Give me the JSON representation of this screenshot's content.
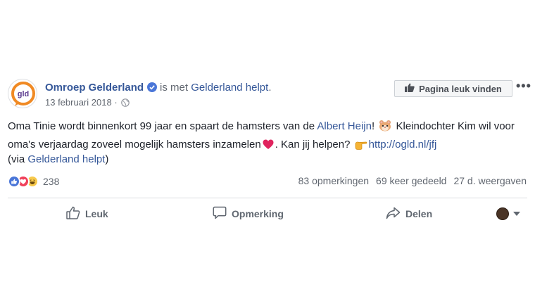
{
  "post": {
    "author": {
      "name": "Omroep Gelderland",
      "logo_text": "gld",
      "verified_icon": "verified-badge-icon"
    },
    "with_text": "is met",
    "with_page": "Gelderland helpt",
    "with_suffix": ".",
    "date": "13 februari 2018",
    "meta_separator": "·",
    "audience_icon": "globe-icon",
    "like_page_label": "Pagina leuk vinden",
    "more_label": "•••",
    "text": {
      "part1": "Oma Tinie wordt binnenkort 99 jaar en spaart de hamsters van de ",
      "link1": "Albert Heijn",
      "part2": "! ",
      "part3": " Kleindochter Kim wil voor oma's verjaardag zoveel mogelijk hamsters inzamelen",
      "part4": ". Kan jij helpen? ",
      "url": "http://ogld.nl/jfj"
    },
    "via": {
      "open": "(via ",
      "link": "Gelderland helpt",
      "close": ")"
    },
    "reactions": {
      "icons": [
        "like-reaction-icon",
        "love-reaction-icon",
        "haha-reaction-icon"
      ],
      "count": "238"
    },
    "stats": {
      "comments": "83 opmerkingen",
      "shares": "69 keer gedeeld",
      "views": "27 d. weergaven"
    },
    "actions": {
      "like": "Leuk",
      "comment": "Opmerking",
      "share": "Delen"
    },
    "colors": {
      "link": "#365899",
      "logo_orange": "#f08a24",
      "logo_purple": "#5b3a8e",
      "verified": "#4a76d8"
    }
  }
}
